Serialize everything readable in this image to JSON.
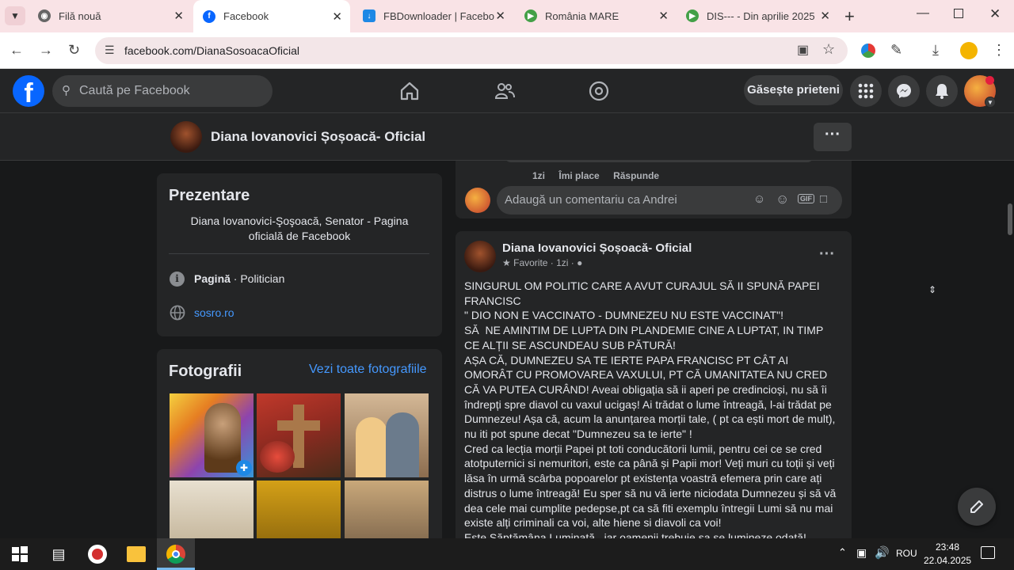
{
  "browser": {
    "tabs": [
      {
        "label": "Filă nouă"
      },
      {
        "label": "Facebook"
      },
      {
        "label": "FBDownloader | Facebook"
      },
      {
        "label": "România MARE"
      },
      {
        "label": "DIS--- - Din aprilie 2025"
      }
    ],
    "url": "facebook.com/DianaSosoacaOficial"
  },
  "fb": {
    "search_placeholder": "Caută pe Facebook",
    "find_friends": "Găsește prieteni",
    "page_name": "Diana Iovanovici Șoșoacă- Oficial"
  },
  "intro": {
    "title": "Prezentare",
    "bio": "Diana Iovanovici-Şoşoacă, Senator - Pagina oficială de Facebook",
    "category_bold": "Pagină",
    "category_rest": " · Politician",
    "website": "sosro.ro"
  },
  "photos": {
    "title": "Fotografii",
    "see_all": "Vezi toate fotografiile"
  },
  "comment_actions": {
    "time": "1zi",
    "like": "Îmi place",
    "reply": "Răspunde",
    "placeholder": "Adaugă un comentariu ca Andrei"
  },
  "post": {
    "author": "Diana Iovanovici Șoșoacă- Oficial",
    "meta": "Favorite · 1zi ·",
    "text": "SINGURUL OM POLITIC CARE A AVUT CURAJUL SĂ II SPUNĂ PAPEI FRANCISC\n\" DIO NON E VACCINATO - DUMNEZEU NU ESTE VACCINAT\"!\nSĂ  NE AMINTIM DE LUPTA DIN PLANDEMIE CINE A LUPTAT, IN TIMP CE ALȚII SE ASCUNDEAU SUB PĂTURĂ!\nAȘA CĂ, DUMNEZEU SA TE IERTE PAPA FRANCISC PT CÂT AI OMORÂT CU PROMOVAREA VAXULUI, PT CĂ UMANITATEA NU CRED CĂ VA PUTEA CURÂND! Aveai obligația să ii aperi pe credincioși, nu să îi îndrepți spre diavol cu vaxul ucigaș! Ai trădat o lume întreagă, l-ai trădat pe Dumnezeu! Așa că, acum la anunțarea morții tale, ( pt ca ești mort de mult), nu iti pot spune decat \"Dumnezeu sa te ierte\" !\nCred ca lecția morții Papei pt toti conducătorii lumii, pentru cei ce se cred atotputernici si nemuritori, este ca până și Papii mor! Veți muri cu toții și veți lăsa în urmă scârba popoarelor pt existența voastră efemera prin care ați distrus o lume întreagă! Eu sper să nu vă ierte niciodata Dumnezeu și să vă dea cele mai cumplite pedepse,pt ca să fiti exemplu întregii Lumi să nu mai existe alți criminali ca voi, alte hiene si diavoli ca voi!\nEste Săptămâna Luminată , iar oamenii trebuie sa se lumineze odată! Trebuie"
  },
  "taskbar": {
    "lang": "ROU",
    "time": "23:48",
    "date": "22.04.2025"
  },
  "colors": {
    "fb_blue": "#0866ff",
    "dark_bg": "#18191a",
    "card_bg": "#242526",
    "link": "#4599ff"
  }
}
